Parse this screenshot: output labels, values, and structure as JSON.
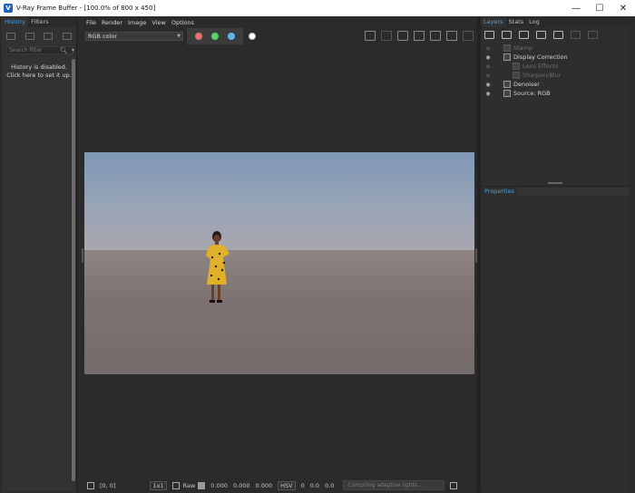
{
  "window": {
    "title": "V-Ray Frame Buffer - [100.0% of 800 x 450]",
    "app_icon": "V",
    "buttons": {
      "minimize": "—",
      "maximize": "☐",
      "close": "✕"
    }
  },
  "left_panel": {
    "tabs": [
      {
        "label": "History"
      },
      {
        "label": "Filters"
      }
    ],
    "search_placeholder": "Search filter",
    "history_message": "History is disabled. Click here to set it up."
  },
  "menu": {
    "items": [
      {
        "label": "File"
      },
      {
        "label": "Render"
      },
      {
        "label": "Image"
      },
      {
        "label": "View"
      },
      {
        "label": "Options"
      }
    ]
  },
  "toolbar": {
    "channel_value": "RGB color",
    "colors": {
      "red": "#e86f6f",
      "green": "#5fd16a",
      "blue": "#5fb7e6"
    }
  },
  "status_bar": {
    "coords": "[0, 0]",
    "zoom": "1x1",
    "raw_label": "Raw",
    "rgb_values": [
      "0.000",
      "0.000",
      "0.000"
    ],
    "color_mode": "HSV",
    "hsv_values": [
      "0",
      "0.0",
      "0.0"
    ],
    "progress_text": "Compiling adaptive lights..."
  },
  "right_panel": {
    "tabs": [
      {
        "label": "Layers"
      },
      {
        "label": "Stats"
      },
      {
        "label": "Log"
      }
    ],
    "layers": [
      {
        "label": "Stamp",
        "visible": false
      },
      {
        "label": "Display Correction",
        "visible": true
      },
      {
        "label": "Lens Effects",
        "visible": false
      },
      {
        "label": "Sharpen/Blur",
        "visible": false
      },
      {
        "label": "Denoiser",
        "visible": true
      },
      {
        "label": "Source: RGB",
        "visible": true
      }
    ],
    "properties_label": "Properties"
  }
}
